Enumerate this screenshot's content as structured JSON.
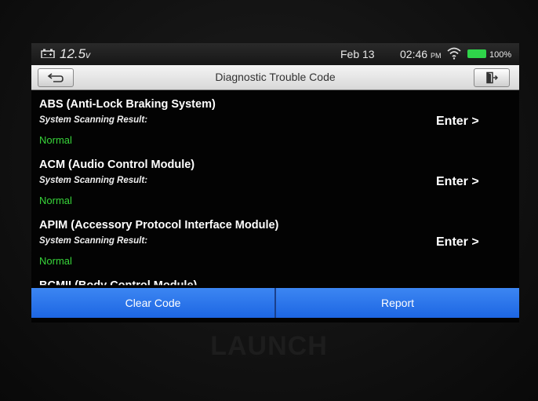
{
  "status_bar": {
    "voltage": "12.5",
    "voltage_unit": "v",
    "date": "Feb 13",
    "time": "02:46",
    "ampm": "PM",
    "battery_pct": "100%",
    "battery_level": 1.0
  },
  "header": {
    "title": "Diagnostic Trouble Code"
  },
  "systems": [
    {
      "name": "ABS (Anti-Lock Braking System)",
      "result_label": "System Scanning Result:",
      "status": "Normal",
      "enter_label": "Enter >"
    },
    {
      "name": "ACM (Audio Control Module)",
      "result_label": "System Scanning Result:",
      "status": "Normal",
      "enter_label": "Enter >"
    },
    {
      "name": "APIM (Accessory Protocol Interface Module)",
      "result_label": "System Scanning Result:",
      "status": "Normal",
      "enter_label": "Enter >"
    },
    {
      "name": "BCMII (Body Control Module)"
    }
  ],
  "actions": {
    "clear_code": "Clear Code",
    "report": "Report"
  },
  "device": {
    "brand": "LAUNCH"
  },
  "colors": {
    "status_normal": "#38d53a",
    "action_button": "#2a78ee",
    "battery": "#2fd44a"
  }
}
